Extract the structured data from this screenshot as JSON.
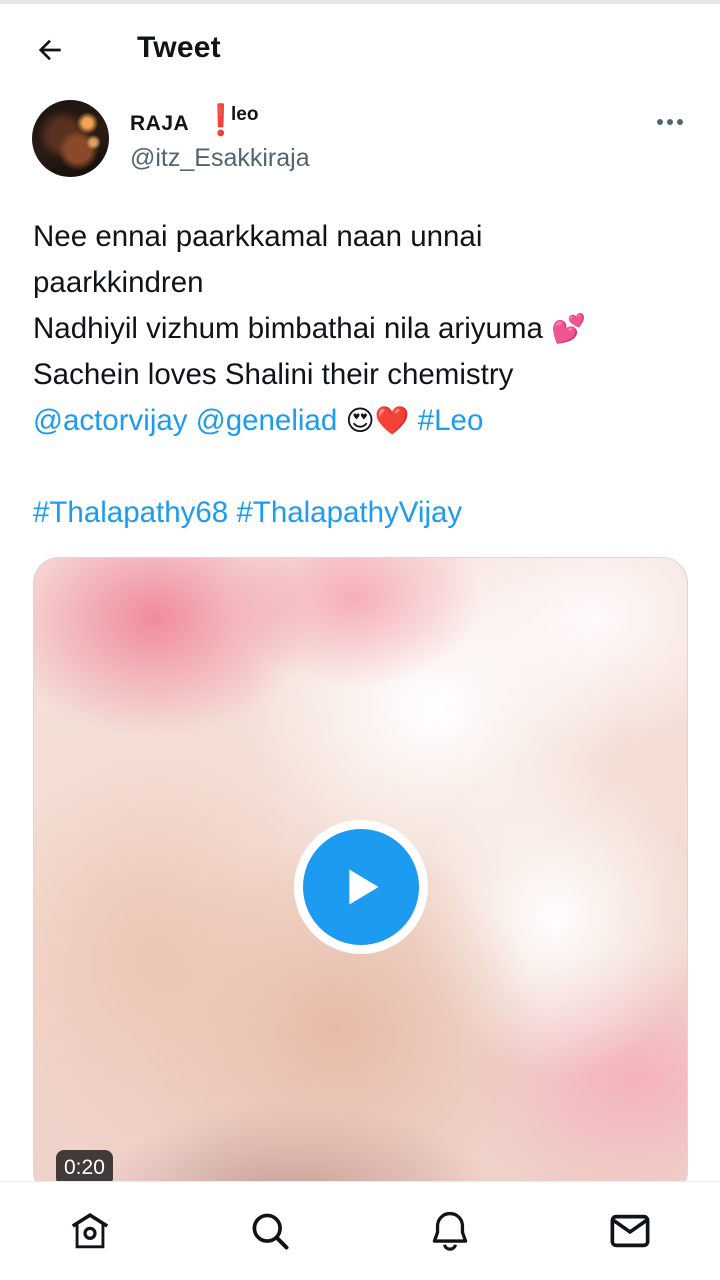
{
  "header": {
    "title": "Tweet"
  },
  "author": {
    "display_name": "RAJA",
    "name_emoji": "❗",
    "name_suffix": "leo",
    "handle": "@itz_Esakkiraja"
  },
  "tweet": {
    "line1": "Nee ennai paarkkamal naan unnai",
    "line2": "paarkkindren",
    "line3": "Nadhiyil vizhum bimbathai nila ariyuma",
    "line3_emoji": "💕",
    "line4": "Sachein loves Shalini their chemistry",
    "mention1": "@actorvijay",
    "mention2": "@geneliad",
    "emojis": "😍❤️",
    "hashtag_leo": "#Leo",
    "hashtag1": "#Thalapathy68",
    "hashtag2": "#ThalapathyVijay"
  },
  "media": {
    "duration": "0:20"
  },
  "colors": {
    "link": "#1d9bf0",
    "text": "#0f1419",
    "secondary": "#536471",
    "play": "#1d9bf0"
  },
  "icons": {
    "back": "arrow-left-icon",
    "more": "more-horizontal-icon",
    "play": "play-icon",
    "nav": [
      "home-icon",
      "search-icon",
      "bell-icon",
      "mail-icon"
    ]
  }
}
